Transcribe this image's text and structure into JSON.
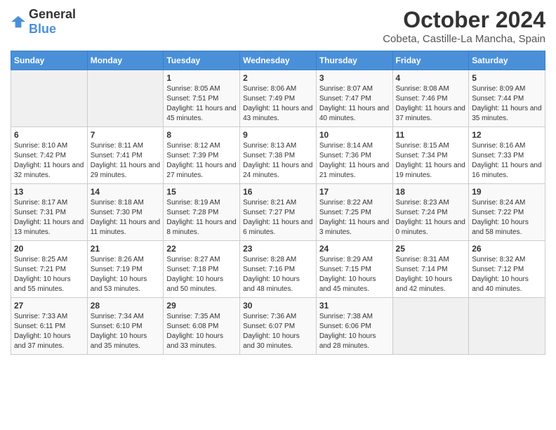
{
  "header": {
    "logo_general": "General",
    "logo_blue": "Blue",
    "month": "October 2024",
    "location": "Cobeta, Castille-La Mancha, Spain"
  },
  "days_of_week": [
    "Sunday",
    "Monday",
    "Tuesday",
    "Wednesday",
    "Thursday",
    "Friday",
    "Saturday"
  ],
  "weeks": [
    [
      {
        "day": "",
        "info": ""
      },
      {
        "day": "",
        "info": ""
      },
      {
        "day": "1",
        "info": "Sunrise: 8:05 AM\nSunset: 7:51 PM\nDaylight: 11 hours and 45 minutes."
      },
      {
        "day": "2",
        "info": "Sunrise: 8:06 AM\nSunset: 7:49 PM\nDaylight: 11 hours and 43 minutes."
      },
      {
        "day": "3",
        "info": "Sunrise: 8:07 AM\nSunset: 7:47 PM\nDaylight: 11 hours and 40 minutes."
      },
      {
        "day": "4",
        "info": "Sunrise: 8:08 AM\nSunset: 7:46 PM\nDaylight: 11 hours and 37 minutes."
      },
      {
        "day": "5",
        "info": "Sunrise: 8:09 AM\nSunset: 7:44 PM\nDaylight: 11 hours and 35 minutes."
      }
    ],
    [
      {
        "day": "6",
        "info": "Sunrise: 8:10 AM\nSunset: 7:42 PM\nDaylight: 11 hours and 32 minutes."
      },
      {
        "day": "7",
        "info": "Sunrise: 8:11 AM\nSunset: 7:41 PM\nDaylight: 11 hours and 29 minutes."
      },
      {
        "day": "8",
        "info": "Sunrise: 8:12 AM\nSunset: 7:39 PM\nDaylight: 11 hours and 27 minutes."
      },
      {
        "day": "9",
        "info": "Sunrise: 8:13 AM\nSunset: 7:38 PM\nDaylight: 11 hours and 24 minutes."
      },
      {
        "day": "10",
        "info": "Sunrise: 8:14 AM\nSunset: 7:36 PM\nDaylight: 11 hours and 21 minutes."
      },
      {
        "day": "11",
        "info": "Sunrise: 8:15 AM\nSunset: 7:34 PM\nDaylight: 11 hours and 19 minutes."
      },
      {
        "day": "12",
        "info": "Sunrise: 8:16 AM\nSunset: 7:33 PM\nDaylight: 11 hours and 16 minutes."
      }
    ],
    [
      {
        "day": "13",
        "info": "Sunrise: 8:17 AM\nSunset: 7:31 PM\nDaylight: 11 hours and 13 minutes."
      },
      {
        "day": "14",
        "info": "Sunrise: 8:18 AM\nSunset: 7:30 PM\nDaylight: 11 hours and 11 minutes."
      },
      {
        "day": "15",
        "info": "Sunrise: 8:19 AM\nSunset: 7:28 PM\nDaylight: 11 hours and 8 minutes."
      },
      {
        "day": "16",
        "info": "Sunrise: 8:21 AM\nSunset: 7:27 PM\nDaylight: 11 hours and 6 minutes."
      },
      {
        "day": "17",
        "info": "Sunrise: 8:22 AM\nSunset: 7:25 PM\nDaylight: 11 hours and 3 minutes."
      },
      {
        "day": "18",
        "info": "Sunrise: 8:23 AM\nSunset: 7:24 PM\nDaylight: 11 hours and 0 minutes."
      },
      {
        "day": "19",
        "info": "Sunrise: 8:24 AM\nSunset: 7:22 PM\nDaylight: 10 hours and 58 minutes."
      }
    ],
    [
      {
        "day": "20",
        "info": "Sunrise: 8:25 AM\nSunset: 7:21 PM\nDaylight: 10 hours and 55 minutes."
      },
      {
        "day": "21",
        "info": "Sunrise: 8:26 AM\nSunset: 7:19 PM\nDaylight: 10 hours and 53 minutes."
      },
      {
        "day": "22",
        "info": "Sunrise: 8:27 AM\nSunset: 7:18 PM\nDaylight: 10 hours and 50 minutes."
      },
      {
        "day": "23",
        "info": "Sunrise: 8:28 AM\nSunset: 7:16 PM\nDaylight: 10 hours and 48 minutes."
      },
      {
        "day": "24",
        "info": "Sunrise: 8:29 AM\nSunset: 7:15 PM\nDaylight: 10 hours and 45 minutes."
      },
      {
        "day": "25",
        "info": "Sunrise: 8:31 AM\nSunset: 7:14 PM\nDaylight: 10 hours and 42 minutes."
      },
      {
        "day": "26",
        "info": "Sunrise: 8:32 AM\nSunset: 7:12 PM\nDaylight: 10 hours and 40 minutes."
      }
    ],
    [
      {
        "day": "27",
        "info": "Sunrise: 7:33 AM\nSunset: 6:11 PM\nDaylight: 10 hours and 37 minutes."
      },
      {
        "day": "28",
        "info": "Sunrise: 7:34 AM\nSunset: 6:10 PM\nDaylight: 10 hours and 35 minutes."
      },
      {
        "day": "29",
        "info": "Sunrise: 7:35 AM\nSunset: 6:08 PM\nDaylight: 10 hours and 33 minutes."
      },
      {
        "day": "30",
        "info": "Sunrise: 7:36 AM\nSunset: 6:07 PM\nDaylight: 10 hours and 30 minutes."
      },
      {
        "day": "31",
        "info": "Sunrise: 7:38 AM\nSunset: 6:06 PM\nDaylight: 10 hours and 28 minutes."
      },
      {
        "day": "",
        "info": ""
      },
      {
        "day": "",
        "info": ""
      }
    ]
  ]
}
